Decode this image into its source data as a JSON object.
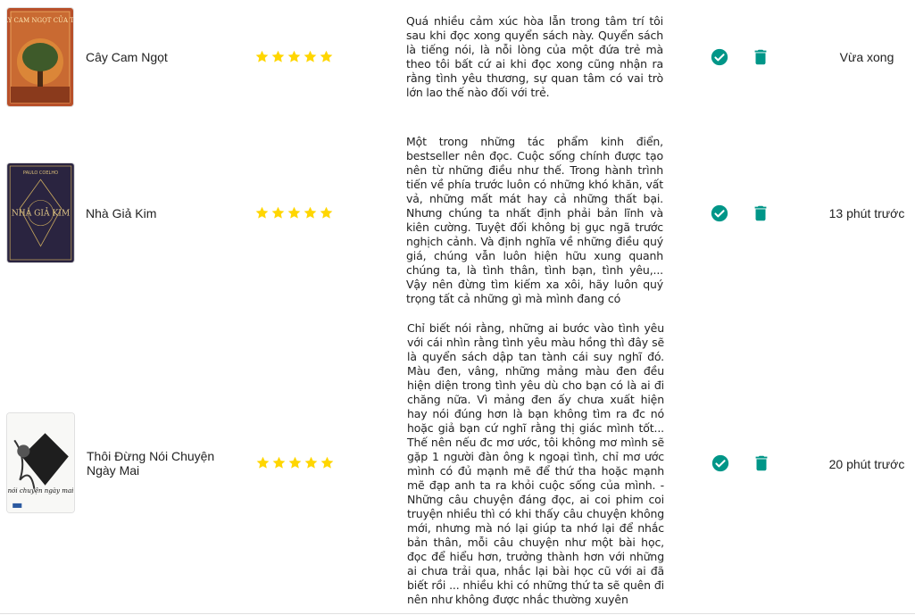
{
  "colors": {
    "star": "#ffd600",
    "check": "#009688",
    "trash": "#009688"
  },
  "reviews": [
    {
      "cover_title": "CÂY CAM NGỌT CỦA TÔI",
      "title": "Cây Cam Ngọt",
      "rating": 5,
      "text": "Quá nhiều cảm xúc hòa lẫn trong tâm trí tôi sau khi đọc xong quyển sách này. Quyển sách là tiếng nói, là nỗi lòng của một đứa trẻ mà theo tôi bất cứ ai khi đọc xong cũng nhận ra rằng tình yêu thương, sự quan tâm có vai trò lớn lao thế nào đối với trẻ.",
      "time": "Vừa xong"
    },
    {
      "cover_author": "PAULO COELHO",
      "cover_title": "NHÀ GIẢ KIM",
      "title": "Nhà Giả Kim",
      "rating": 5,
      "text": "Một trong những tác phẩm kinh điển, bestseller nên đọc. Cuộc sống chính được tạo nên từ những điều như thế. Trong hành trình tiến về phía trước luôn có những khó khăn, vất vả, những mất mát hay cả những thất bại. Nhưng chúng ta nhất định phải bản lĩnh và kiên cường. Tuyệt đối không bị gục ngã trước nghịch cảnh. Và định nghĩa về những điều quý giá, chúng vẫn luôn hiện hữu xung quanh chúng ta, là tình thân, tình bạn, tình yêu,... Vậy nên đừng tìm kiếm xa xôi, hãy luôn quý trọng tất cả những gì mà mình đang có",
      "time": "13 phút trước"
    },
    {
      "cover_title": "nói chuyện ngày mai",
      "title": "Thôi Đừng Nói Chuyện Ngày Mai",
      "rating": 5,
      "text": "Chỉ biết nói rằng, những ai bước vào tình yêu với cái nhìn rằng tình yêu màu hồng thì đây sẽ là quyển sách dập tan tành cái suy nghĩ đó. Màu đen, vâng, những mảng màu đen đều hiện diện trong tình yêu dù cho bạn có là ai đi chăng nữa. Vì mảng đen ấy chưa xuất hiện hay nói đúng hơn là bạn không tìm ra đc nó hoặc giả bạn cứ nghĩ rằng thị giác mình tốt... Thế nên nếu đc mơ ước, tôi không mơ mình sẽ gặp 1 người đàn ông k ngoại tình, chỉ mơ ước mình có đủ mạnh mẽ để thứ tha hoặc mạnh mẽ đạp anh ta ra khỏi cuộc sống của mình. - Những câu chuyện đáng đọc, ai coi phim coi truyện nhiều thì có khi thấy câu chuyện không mới, nhưng mà nó lại giúp ta nhớ lại để nhắc bản thân, mỗi câu chuyện như một bài học, đọc để hiểu hơn, trưởng thành hơn với những ai chưa trải qua, nhắc lại bài học cũ với ai đã biết rồi ... nhiều khi có những thứ ta sẽ quên đi nên như không được nhắc thường xuyên",
      "time": "20 phút trước"
    }
  ]
}
